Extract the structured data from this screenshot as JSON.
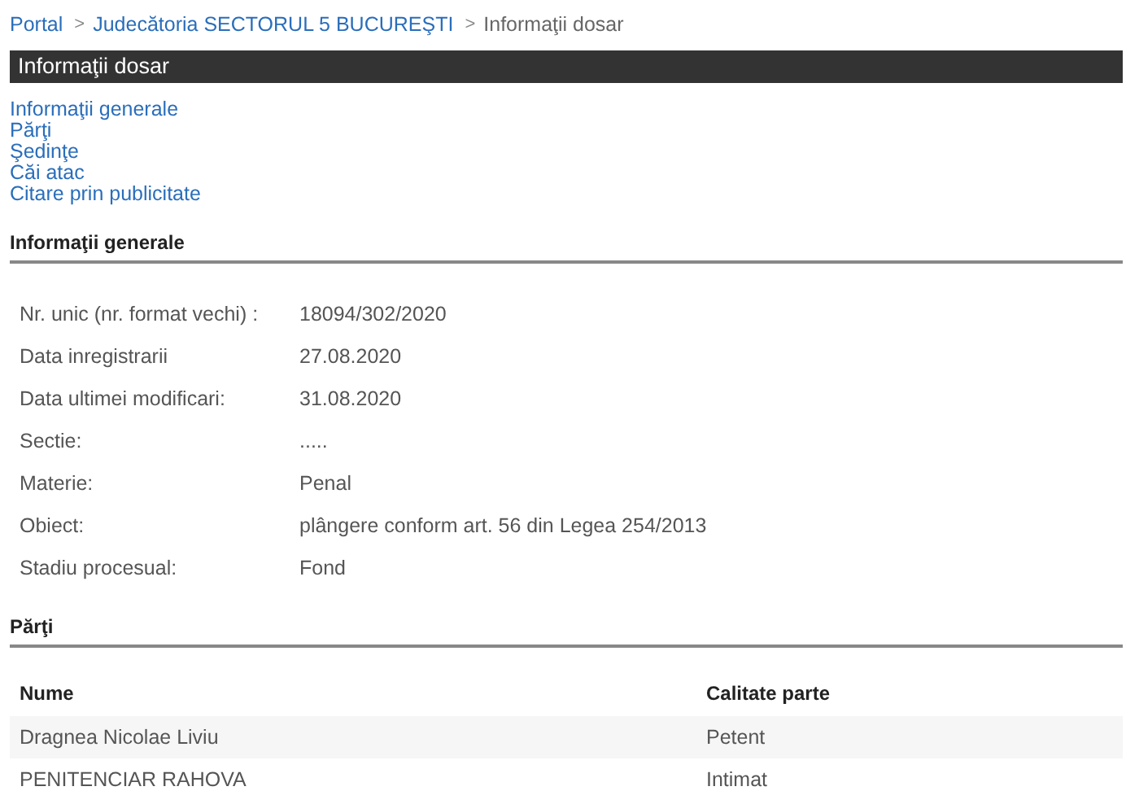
{
  "breadcrumb": [
    {
      "label": "Portal",
      "kind": "link"
    },
    {
      "label": ">",
      "kind": "separator"
    },
    {
      "label": "Judecătoria SECTORUL 5 BUCUREŞTI",
      "kind": "link"
    },
    {
      "label": ">",
      "kind": "separator"
    },
    {
      "label": "Informaţii dosar",
      "kind": "current"
    }
  ],
  "title": "Informaţii dosar",
  "nav_links": [
    "Informaţii generale",
    "Părţi",
    "Şedinţe",
    "Căi atac",
    "Citare prin publicitate"
  ],
  "general": {
    "heading": "Informaţii generale",
    "fields": [
      {
        "label": "Nr. unic (nr. format vechi) :",
        "value": "18094/302/2020"
      },
      {
        "label": "Data inregistrarii",
        "value": "27.08.2020"
      },
      {
        "label": "Data ultimei modificari:",
        "value": "31.08.2020"
      },
      {
        "label": "Sectie:",
        "value": "....."
      },
      {
        "label": "Materie:",
        "value": "Penal"
      },
      {
        "label": "Obiect:",
        "value": "plângere conform art. 56 din Legea 254/2013"
      },
      {
        "label": "Stadiu procesual:",
        "value": "Fond"
      }
    ]
  },
  "parties": {
    "heading": "Părţi",
    "columns": [
      "Nume",
      "Calitate parte"
    ],
    "rows": [
      [
        "Dragnea Nicolae Liviu",
        "Petent"
      ],
      [
        "PENITENCIAR RAHOVA",
        "Intimat"
      ]
    ]
  }
}
